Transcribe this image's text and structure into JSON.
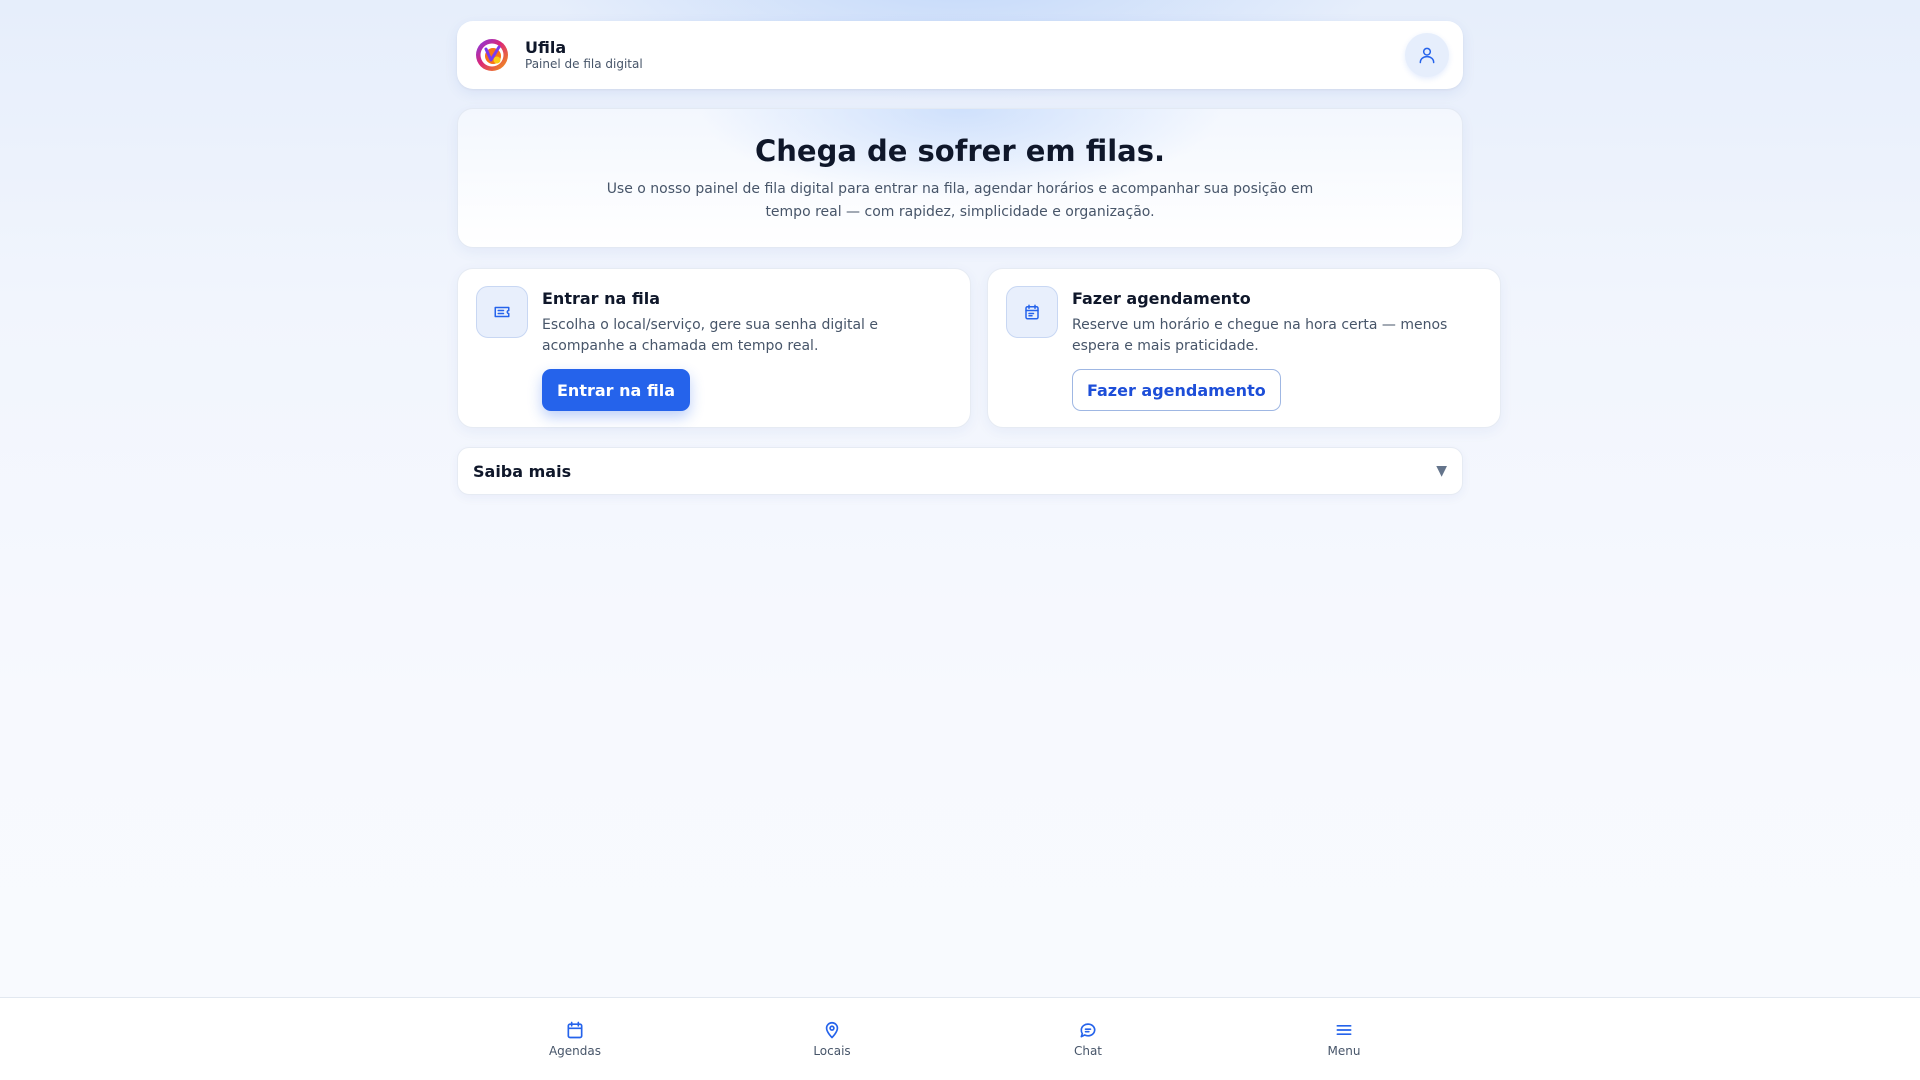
{
  "header": {
    "brand_name": "Ufila",
    "brand_subtitle": "Painel de fila digital",
    "user_icon": "user-icon"
  },
  "hero": {
    "title": "Chega de sofrer em filas.",
    "description": "Use o nosso painel de fila digital para entrar na fila, agendar horários e acompanhar sua posição em tempo real — com rapidez, simplicidade e organização."
  },
  "cards": [
    {
      "icon": "ticket-icon",
      "title": "Entrar na fila",
      "description": "Escolha o local/serviço, gere sua senha digital e acompanhe a chamada em tempo real.",
      "button_label": "Entrar na fila"
    },
    {
      "icon": "calendar-icon",
      "title": "Fazer agendamento",
      "description": "Reserve um horário e chegue na hora certa — menos espera e mais praticidade.",
      "button_label": "Fazer agendamento"
    }
  ],
  "more": {
    "label": "Saiba mais",
    "chevron": "▼"
  },
  "bottom_nav": [
    {
      "label": "Agendas",
      "icon": "calendar-icon"
    },
    {
      "label": "Locais",
      "icon": "map-pin-icon"
    },
    {
      "label": "Chat",
      "icon": "chat-icon"
    },
    {
      "label": "Menu",
      "icon": "menu-icon"
    }
  ],
  "colors": {
    "accent": "#2563eb",
    "accent_dark": "#1d4ed8",
    "text": "#0f172a",
    "muted": "#475569"
  }
}
